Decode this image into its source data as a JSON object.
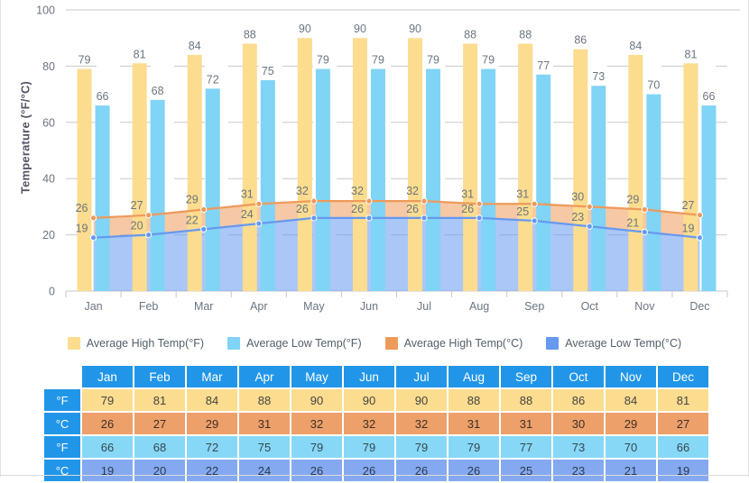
{
  "chart_data": {
    "type": "bar",
    "title": "",
    "xlabel": "",
    "ylabel": "Temperature (°F/°C)",
    "ylim": [
      0,
      100
    ],
    "yticks": [
      0,
      20,
      40,
      60,
      80,
      100
    ],
    "grid": true,
    "legend_position": "bottom",
    "categories": [
      "Jan",
      "Feb",
      "Mar",
      "Apr",
      "May",
      "Jun",
      "Jul",
      "Aug",
      "Sep",
      "Oct",
      "Nov",
      "Dec"
    ],
    "series": [
      {
        "name": "Average High Temp(°F)",
        "type": "bar",
        "color": "#FCDC8F",
        "values": [
          79,
          81,
          84,
          88,
          90,
          90,
          90,
          88,
          88,
          86,
          84,
          81
        ]
      },
      {
        "name": "Average Low Temp(°F)",
        "type": "bar",
        "color": "#80D4F5",
        "values": [
          66,
          68,
          72,
          75,
          79,
          79,
          79,
          79,
          77,
          73,
          70,
          66
        ]
      },
      {
        "name": "Average High Temp(°C)",
        "type": "area",
        "color": "#EE9A5B",
        "values": [
          26,
          27,
          29,
          31,
          32,
          32,
          32,
          31,
          31,
          30,
          29,
          27
        ]
      },
      {
        "name": "Average Low Temp(°C)",
        "type": "area",
        "color": "#6699F0",
        "values": [
          19,
          20,
          22,
          24,
          26,
          26,
          26,
          26,
          25,
          23,
          21,
          19
        ]
      }
    ]
  },
  "legend": {
    "items": [
      {
        "label": "Average High Temp(°F)",
        "color": "#FCDC8F"
      },
      {
        "label": "Average Low Temp(°F)",
        "color": "#80D4F5"
      },
      {
        "label": "Average High Temp(°C)",
        "color": "#EE9A5B"
      },
      {
        "label": "Average Low Temp(°C)",
        "color": "#6699F0"
      }
    ]
  },
  "table": {
    "corner": "",
    "months": [
      "Jan",
      "Feb",
      "Mar",
      "Apr",
      "May",
      "Jun",
      "Jul",
      "Aug",
      "Sep",
      "Oct",
      "Nov",
      "Dec"
    ],
    "rows": [
      {
        "label": "°F",
        "style": "cell-hi-f",
        "values": [
          79,
          81,
          84,
          88,
          90,
          90,
          90,
          88,
          88,
          86,
          84,
          81
        ]
      },
      {
        "label": "°C",
        "style": "cell-hi-c",
        "values": [
          26,
          27,
          29,
          31,
          32,
          32,
          32,
          31,
          31,
          30,
          29,
          27
        ]
      },
      {
        "label": "°F",
        "style": "cell-lo-f",
        "values": [
          66,
          68,
          72,
          75,
          79,
          79,
          79,
          79,
          77,
          73,
          70,
          66
        ]
      },
      {
        "label": "°C",
        "style": "cell-lo-c",
        "values": [
          19,
          20,
          22,
          24,
          26,
          26,
          26,
          26,
          25,
          23,
          21,
          19
        ]
      }
    ]
  }
}
